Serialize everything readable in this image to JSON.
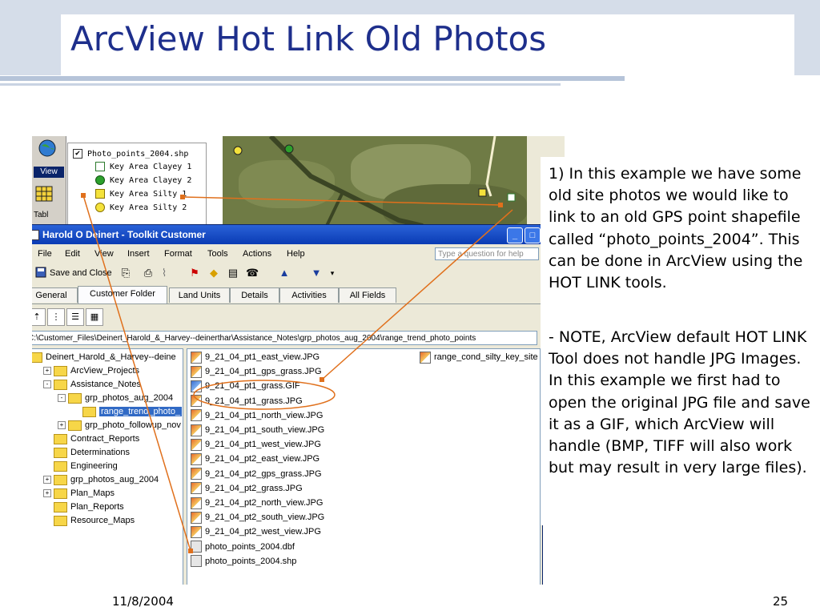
{
  "slide": {
    "title": "ArcView Hot Link Old Photos",
    "date": "11/8/2004",
    "page_number": "25"
  },
  "arcview": {
    "sidebar": [
      "View",
      "Tabl"
    ],
    "legend_title": "Photo_points_2004.shp",
    "legend_items": [
      "Key Area Clayey 1",
      "Key Area Clayey 2",
      "Key Area Silty 1",
      "Key Area Silty 2"
    ]
  },
  "window": {
    "title": "Harold O Deinert - Toolkit Customer",
    "menu": [
      "File",
      "Edit",
      "View",
      "Insert",
      "Format",
      "Tools",
      "Actions",
      "Help"
    ],
    "question_placeholder": "Type a question for help",
    "save_close": "Save and Close",
    "tabs": [
      "General",
      "Customer Folder",
      "Land Units",
      "Details",
      "Activities",
      "All Fields"
    ],
    "path": "C:\\Customer_Files\\Deinert_Harold_&_Harvey--deinerthar\\Assistance_Notes\\grp_photos_aug_2004\\range_trend_photo_points"
  },
  "tree": [
    {
      "label": "Deinert_Harold_&_Harvey--deine",
      "indent": 0,
      "expander": ""
    },
    {
      "label": "ArcView_Projects",
      "indent": 1,
      "expander": "+"
    },
    {
      "label": "Assistance_Notes",
      "indent": 1,
      "expander": "-"
    },
    {
      "label": "grp_photos_aug_2004",
      "indent": 2,
      "expander": "-"
    },
    {
      "label": "range_trend_photo_",
      "indent": 3,
      "expander": "",
      "selected": true
    },
    {
      "label": "grp_photo_followup_nov",
      "indent": 2,
      "expander": "+"
    },
    {
      "label": "Contract_Reports",
      "indent": 1,
      "expander": ""
    },
    {
      "label": "Determinations",
      "indent": 1,
      "expander": ""
    },
    {
      "label": "Engineering",
      "indent": 1,
      "expander": ""
    },
    {
      "label": "grp_photos_aug_2004",
      "indent": 1,
      "expander": "+"
    },
    {
      "label": "Plan_Maps",
      "indent": 1,
      "expander": "+"
    },
    {
      "label": "Plan_Reports",
      "indent": 1,
      "expander": ""
    },
    {
      "label": "Resource_Maps",
      "indent": 1,
      "expander": ""
    }
  ],
  "files": [
    "9_21_04_pt1_east_view.JPG",
    "9_21_04_pt1_gps_grass.JPG",
    "9_21_04_pt1_grass.GIF",
    "9_21_04_pt1_grass.JPG",
    "9_21_04_pt1_north_view.JPG",
    "9_21_04_pt1_south_view.JPG",
    "9_21_04_pt1_west_view.JPG",
    "9_21_04_pt2_east_view.JPG",
    "9_21_04_pt2_gps_grass.JPG",
    "9_21_04_pt2_grass.JPG",
    "9_21_04_pt2_north_view.JPG",
    "9_21_04_pt2_south_view.JPG",
    "9_21_04_pt2_west_view.JPG",
    "photo_points_2004.dbf",
    "photo_points_2004.shp"
  ],
  "files_col2": [
    "range_cond_silty_key_site"
  ],
  "note": {
    "para1": "1) In this example we have some old site photos we would like to link to an old GPS point shapefile called “photo_points_2004”.  This can be done in ArcView using the HOT LINK tools.",
    "para2": " - NOTE, ArcView default HOT LINK Tool does not handle JPG Images.  In this example we first had to open the original JPG file and save it as a GIF, which ArcView will handle (BMP, TIFF will also work but may result in very large files)."
  },
  "colors": {
    "title": "#1e2f8c",
    "annotation": "#e0701c",
    "selection": "#316ac5"
  }
}
